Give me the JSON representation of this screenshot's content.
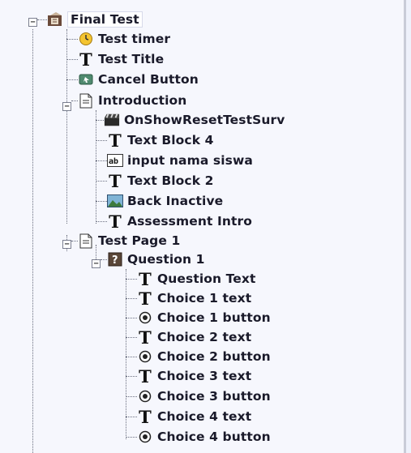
{
  "tree": {
    "root": {
      "label": "Final Test",
      "icon": "final-test-icon"
    },
    "items": [
      {
        "label": "Test timer",
        "icon": "timer-icon"
      },
      {
        "label": "Test Title",
        "icon": "text-icon"
      },
      {
        "label": "Cancel Button",
        "icon": "button-icon"
      },
      {
        "label": "Introduction",
        "icon": "page-icon",
        "children": [
          {
            "label": "OnShowResetTestSurv",
            "icon": "action-icon"
          },
          {
            "label": "Text Block 4",
            "icon": "text-icon"
          },
          {
            "label": "input nama siswa",
            "icon": "input-field-icon"
          },
          {
            "label": "Text Block 2",
            "icon": "text-icon"
          },
          {
            "label": "Back Inactive",
            "icon": "image-icon"
          },
          {
            "label": "Assessment Intro",
            "icon": "text-icon"
          }
        ]
      },
      {
        "label": "Test Page 1",
        "icon": "page-icon",
        "question": {
          "label": "Question 1",
          "icon": "question-icon",
          "children": [
            {
              "label": "Question Text",
              "icon": "text-icon"
            },
            {
              "label": "Choice 1 text",
              "icon": "text-icon"
            },
            {
              "label": "Choice 1 button",
              "icon": "radio-button-icon"
            },
            {
              "label": "Choice 2 text",
              "icon": "text-icon"
            },
            {
              "label": "Choice 2 button",
              "icon": "radio-button-icon"
            },
            {
              "label": "Choice 3 text",
              "icon": "text-icon"
            },
            {
              "label": "Choice 3 button",
              "icon": "radio-button-icon"
            },
            {
              "label": "Choice 4 text",
              "icon": "text-icon"
            },
            {
              "label": "Choice 4 button",
              "icon": "radio-button-icon"
            }
          ]
        }
      }
    ]
  }
}
